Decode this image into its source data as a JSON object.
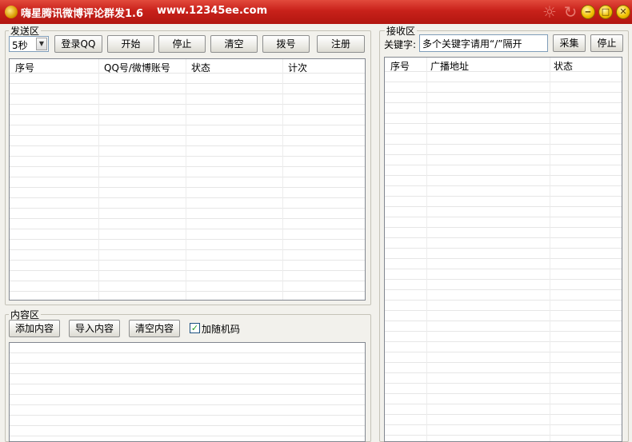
{
  "window": {
    "title": "嗨星腾讯微博评论群发1.6",
    "url": "www.12345ee.com",
    "controls": [
      "minimize-icon",
      "maximize-icon",
      "close-icon"
    ]
  },
  "send_area": {
    "label": "发送区",
    "interval_select": {
      "value": "5秒"
    },
    "buttons": {
      "login": "登录QQ",
      "start": "开始",
      "stop": "停止",
      "clear": "清空",
      "dial": "拨号",
      "register": "注册"
    },
    "columns": [
      "序号",
      "QQ号/微博账号",
      "状态",
      "计次"
    ],
    "rows": []
  },
  "content_area": {
    "label": "内容区",
    "buttons": {
      "add": "添加内容",
      "import": "导入内容",
      "clear": "清空内容"
    },
    "random_code": {
      "label": "加随机码",
      "checked": true
    },
    "rows": []
  },
  "receive_area": {
    "label": "接收区",
    "keyword": {
      "label": "关键字:",
      "value": "多个关键字请用“/”隔开"
    },
    "buttons": {
      "collect": "采集",
      "stop": "停止"
    },
    "columns": [
      "序号",
      "广播地址",
      "状态"
    ],
    "rows": []
  },
  "colors": {
    "titlebar": "#c8211a",
    "window_bg": "#f2f1ec",
    "check": "#21a121"
  }
}
